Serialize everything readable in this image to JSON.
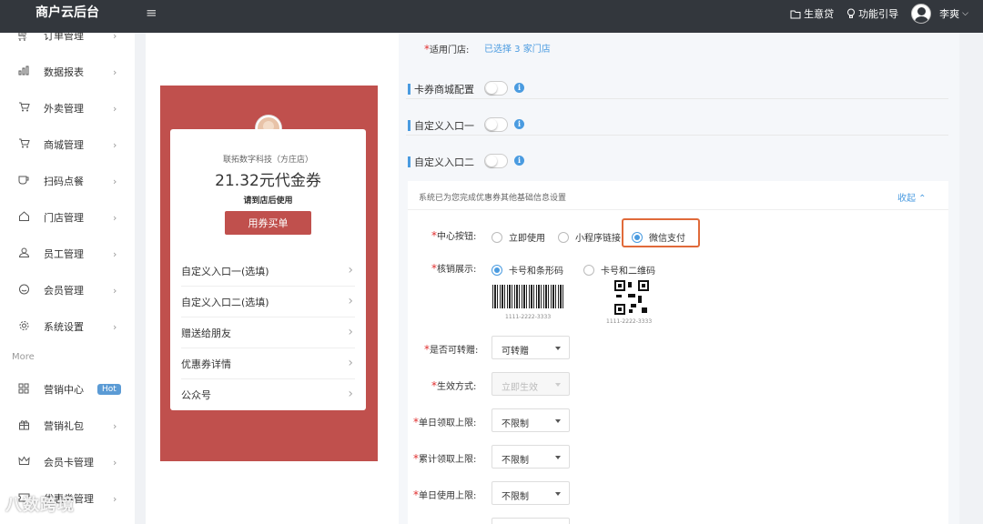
{
  "topbar": {
    "brand": "商户云后台",
    "menu_toggle": "≡",
    "loan": "生意贷",
    "guide": "功能引导",
    "user": "李爽",
    "caret": "⌵"
  },
  "sidebar": {
    "items": [
      {
        "label": "订单管理",
        "icon": "cart-icon"
      },
      {
        "label": "数据报表",
        "icon": "bar-chart-icon"
      },
      {
        "label": "外卖管理",
        "icon": "cart-icon"
      },
      {
        "label": "商城管理",
        "icon": "cart-icon"
      },
      {
        "label": "扫码点餐",
        "icon": "cup-icon"
      },
      {
        "label": "门店管理",
        "icon": "home-icon"
      },
      {
        "label": "员工管理",
        "icon": "user-icon"
      },
      {
        "label": "会员管理",
        "icon": "smile-icon"
      },
      {
        "label": "系统设置",
        "icon": "gear-icon"
      }
    ],
    "more_label": "More",
    "more_items": [
      {
        "label": "营销中心",
        "icon": "grid-icon",
        "badge": "Hot"
      },
      {
        "label": "营销礼包",
        "icon": "gift-icon"
      },
      {
        "label": "会员卡管理",
        "icon": "crown-icon"
      },
      {
        "label": "优惠券管理",
        "icon": "coupon-icon"
      }
    ],
    "arrow": "›"
  },
  "watermark": "八数跨境",
  "preview": {
    "store_name": "联拓数字科技（方庄店）",
    "coupon_title": "21.32元代金券",
    "coupon_sub": "请到店后使用",
    "use_button": "用券买单",
    "rows": [
      "自定义入口一(选填)",
      "自定义入口二(选填)",
      "赠送给朋友",
      "优惠券详情",
      "公众号"
    ],
    "chev": "›",
    "accent": "#c0504d"
  },
  "form": {
    "stores_label": "适用门店:",
    "stores_value": "已选择 3 家门店",
    "sections": [
      "卡券商城配置",
      "自定义入口一",
      "自定义入口二"
    ],
    "info": "i",
    "panel_head": "系统已为您完成优惠券其他基础信息设置",
    "collapse": "收起 ⌃",
    "center_button_label": "中心按钮:",
    "center_options": [
      "立即使用",
      "小程序链接",
      "微信支付"
    ],
    "center_selected": "微信支付",
    "verify_label": "核销展示:",
    "verify_options": [
      "卡号和条形码",
      "卡号和二维码"
    ],
    "verify_selected": "卡号和条形码",
    "code_number": "1111-2222-3333",
    "transfer_label": "是否可转赠:",
    "transfer_value": "可转赠",
    "effect_label": "生效方式:",
    "effect_value": "立即生效",
    "daily_get_label": "单日领取上限:",
    "daily_get_value": "不限制",
    "total_get_label": "累计领取上限:",
    "total_get_value": "不限制",
    "daily_use_label": "单日使用上限:",
    "daily_use_value": "不限制",
    "star": "*"
  },
  "colors": {
    "topbar": "#33373d",
    "blue": "#4a9be0",
    "highlight": "#e06a3a",
    "required": "#e03030"
  }
}
